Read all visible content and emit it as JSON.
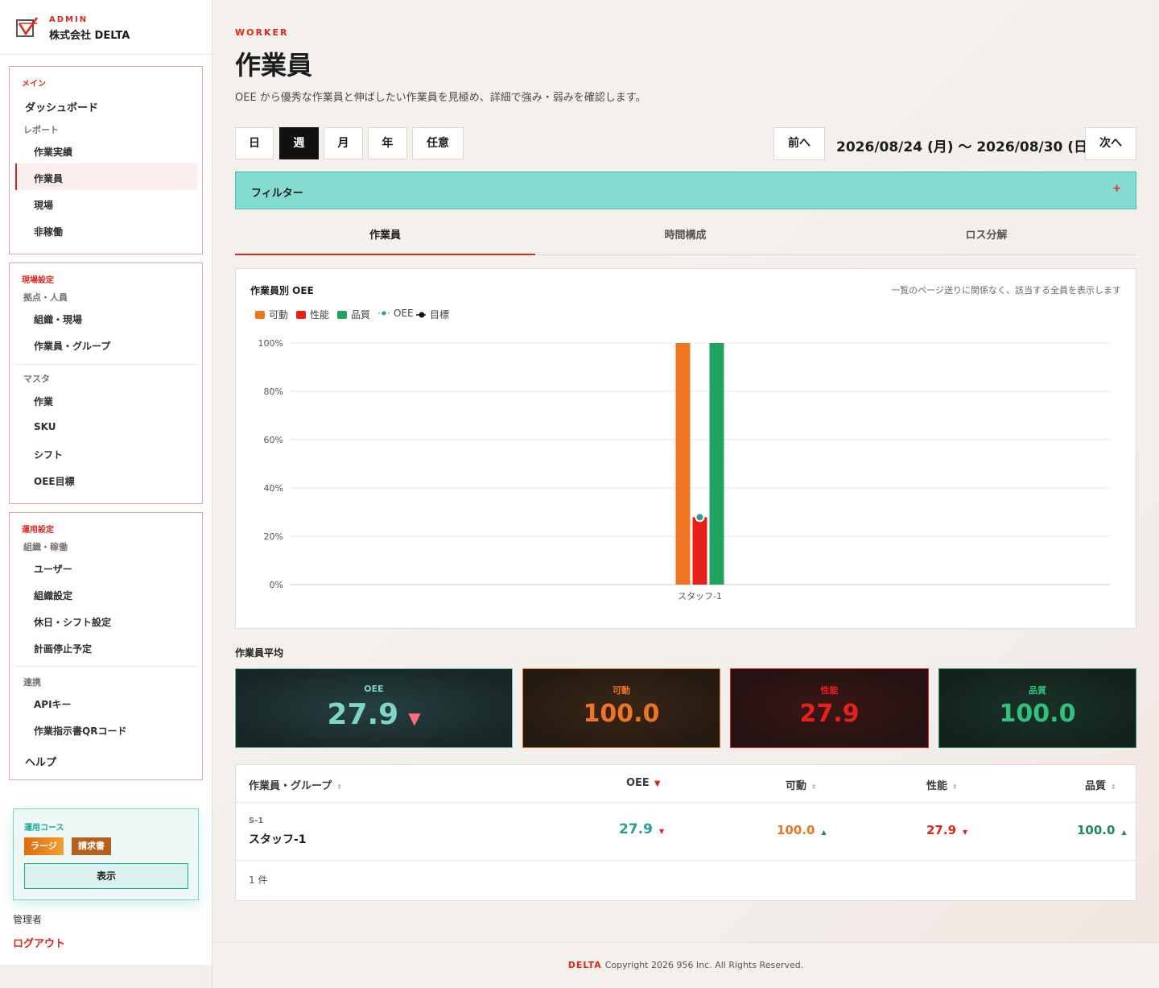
{
  "brand": {
    "role_label": "ADMIN",
    "company": "株式会社 DELTA"
  },
  "sidebar": {
    "main_section": "メイン",
    "dashboard": "ダッシュボード",
    "report_group": "レポート",
    "report_items": [
      "作業実績",
      "作業員",
      "現場",
      "非稼働"
    ],
    "site_section": "現場設定",
    "base_group": "拠点・人員",
    "base_items": [
      "組織・現場",
      "作業員・グループ"
    ],
    "master_group": "マスタ",
    "master_items": [
      "作業",
      "SKU",
      "シフト",
      "OEE目標"
    ],
    "ops_section": "運用設定",
    "org_group": "組織・稼働",
    "org_items": [
      "ユーザー",
      "組織設定",
      "休日・シフト設定",
      "計画停止予定"
    ],
    "link_group": "連携",
    "link_items": [
      "APIキー",
      "作業指示書QRコード"
    ],
    "help": "ヘルプ",
    "plan_label": "運用コース",
    "plan_badges": [
      "ラージ",
      "請求書"
    ],
    "plan_button": "表示",
    "user_role": "管理者",
    "logout": "ログアウト"
  },
  "header": {
    "eyebrow": "WORKER",
    "title": "作業員",
    "description": "OEE から優秀な作業員と伸ばしたい作業員を見極め、詳細で強み・弱みを確認します。"
  },
  "period": {
    "buttons": [
      "日",
      "週",
      "月",
      "年",
      "任意"
    ],
    "selected": "週",
    "prev": "前へ",
    "next": "次へ",
    "range": "2026/08/24 (月) 〜 2026/08/30 (日)"
  },
  "filter": {
    "label": "フィルター",
    "toggle": "+"
  },
  "tabs": [
    "作業員",
    "時間構成",
    "ロス分解"
  ],
  "chart": {
    "title": "作業員別 OEE",
    "note": "一覧のページ送りに関係なく、該当する全員を表示します"
  },
  "chart_data": {
    "type": "bar",
    "categories": [
      "スタッフ-1"
    ],
    "series": [
      {
        "name": "可動",
        "values": [
          100
        ],
        "color": "#f07522"
      },
      {
        "name": "性能",
        "values": [
          27.9
        ],
        "color": "#e8201a"
      },
      {
        "name": "品質",
        "values": [
          100
        ],
        "color": "#1fa35e"
      },
      {
        "name": "OEE",
        "values": [
          27.9
        ],
        "color": "#2a9d94",
        "kind": "point"
      },
      {
        "name": "目標",
        "values": [],
        "color": "#111111",
        "kind": "marker"
      }
    ],
    "ylim": [
      0,
      100
    ],
    "yticks": [
      "0%",
      "20%",
      "40%",
      "60%",
      "80%",
      "100%"
    ],
    "grid": true,
    "legend": "top-left"
  },
  "averages": {
    "title": "作業員平均",
    "oee": {
      "label": "OEE",
      "value": "27.9",
      "color": "#7fd3c8"
    },
    "availability": {
      "label": "可動",
      "value": "100.0",
      "color": "#f07522"
    },
    "performance": {
      "label": "性能",
      "value": "27.9",
      "color": "#e8201a"
    },
    "quality": {
      "label": "品質",
      "value": "100.0",
      "color": "#2ec27e"
    }
  },
  "table": {
    "headers": [
      "作業員・グループ",
      "OEE",
      "可動",
      "性能",
      "品質"
    ],
    "sort_icon": "⇕",
    "rows": [
      {
        "code": "S-1",
        "name": "スタッフ-1",
        "oee": "27.9",
        "availability": "100.0",
        "performance": "27.9",
        "quality": "100.0"
      }
    ],
    "count": "1 件"
  },
  "footer": {
    "brand": "DELTA",
    "copyright": "Copyright 2026 956 Inc. All Rights Reserved."
  }
}
